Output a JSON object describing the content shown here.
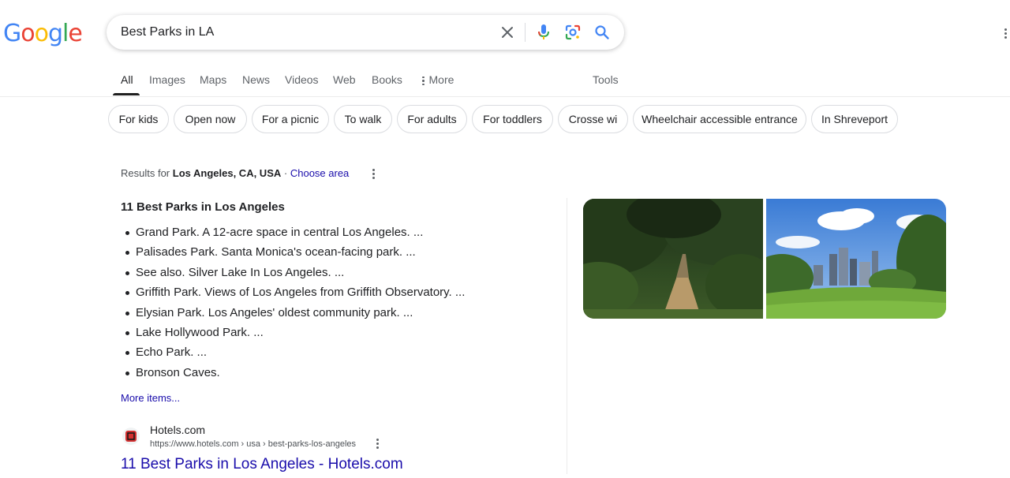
{
  "logo": {
    "letters": [
      "G",
      "o",
      "o",
      "g",
      "l",
      "e"
    ],
    "colors": [
      "#4285F4",
      "#EA4335",
      "#FBBC05",
      "#4285F4",
      "#34A853",
      "#EA4335"
    ]
  },
  "search": {
    "query": "Best Parks in LA",
    "icons": [
      "close-icon",
      "microphone-icon",
      "lens-icon",
      "search-icon"
    ]
  },
  "tabs": [
    {
      "label": "All",
      "active": true
    },
    {
      "label": "Images"
    },
    {
      "label": "Maps"
    },
    {
      "label": "News"
    },
    {
      "label": "Videos"
    },
    {
      "label": "Web"
    },
    {
      "label": "Books"
    },
    {
      "label": "More"
    },
    {
      "label": "Tools"
    }
  ],
  "chips": [
    "For kids",
    "Open now",
    "For a picnic",
    "To walk",
    "For adults",
    "For toddlers",
    "Crosse wi",
    "Wheelchair accessible entrance",
    "In Shreveport"
  ],
  "location": {
    "prefix": "Results for",
    "place": "Los Angeles, CA, USA",
    "separator": "·",
    "choose_label": "Choose area"
  },
  "snippet": {
    "title": "11 Best Parks in Los Angeles",
    "items": [
      "Grand Park. A 12-acre space in central Los Angeles. ...",
      "Palisades Park. Santa Monica's ocean-facing park. ...",
      "See also. Silver Lake In Los Angeles. ...",
      "Griffith Park. Views of Los Angeles from Griffith Observatory. ...",
      "Elysian Park. Los Angeles' oldest community park. ...",
      "Lake Hollywood Park. ...",
      "Echo Park. ...",
      "Bronson Caves."
    ],
    "more_label": "More items..."
  },
  "result": {
    "site_name": "Hotels.com",
    "url": "https://www.hotels.com › usa › best-parks-los-angeles",
    "title": "11 Best Parks in Los Angeles - Hotels.com",
    "favicon_color": "#d32f2f"
  },
  "colors": {
    "link": "#1a0dab",
    "text": "#202124",
    "muted": "#5f6368"
  }
}
